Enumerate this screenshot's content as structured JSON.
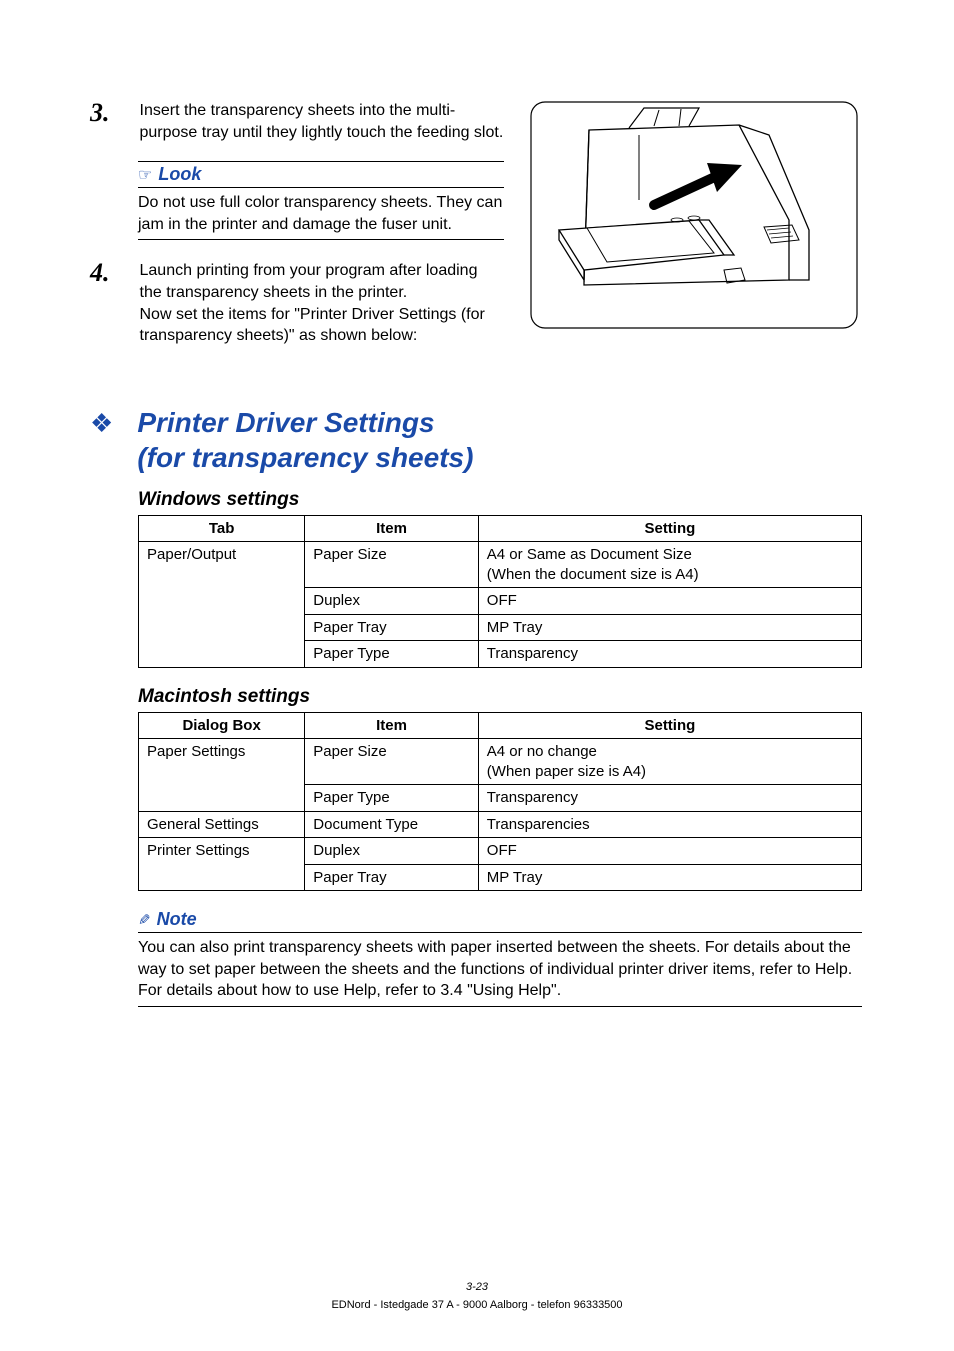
{
  "steps": {
    "s3": {
      "num": "3.",
      "text": "Insert the transparency sheets into the multi-purpose tray until they lightly touch the feeding slot."
    },
    "s4": {
      "num": "4.",
      "text": "Launch printing from your program after loading the transparency sheets in the printer.\nNow set the items for \"Printer Driver Settings (for transparency sheets)\" as shown below:"
    }
  },
  "look": {
    "label": "Look",
    "text": "Do not use full color transparency sheets. They can jam in the printer and damage the fuser unit."
  },
  "section": {
    "title_line1": "Printer Driver Settings",
    "title_line2": "(for transparency sheets)"
  },
  "windows": {
    "heading": "Windows settings",
    "th": {
      "c1": "Tab",
      "c2": "Item",
      "c3": "Setting"
    },
    "rows": {
      "r1": {
        "c1": "Paper/Output",
        "c2": "Paper Size",
        "c3": "A4 or Same as Document Size\n(When the document size is A4)"
      },
      "r2": {
        "c2": "Duplex",
        "c3": "OFF"
      },
      "r3": {
        "c2": "Paper Tray",
        "c3": "MP Tray"
      },
      "r4": {
        "c2": "Paper Type",
        "c3": "Transparency"
      }
    }
  },
  "mac": {
    "heading": "Macintosh settings",
    "th": {
      "c1": "Dialog Box",
      "c2": "Item",
      "c3": "Setting"
    },
    "rows": {
      "r1": {
        "c1": "Paper Settings",
        "c2": "Paper Size",
        "c3": "A4 or no change\n(When paper size is A4)"
      },
      "r2": {
        "c2": "Paper Type",
        "c3": "Transparency"
      },
      "r3": {
        "c1": "General Settings",
        "c2": "Document Type",
        "c3": "Transparencies"
      },
      "r4": {
        "c1": "Printer Settings",
        "c2": "Duplex",
        "c3": "OFF"
      },
      "r5": {
        "c2": "Paper Tray",
        "c3": "MP Tray"
      }
    }
  },
  "note": {
    "label": "Note",
    "text": "You can also print transparency sheets with paper inserted between the sheets. For details about the way to set paper between the sheets and the functions of individual printer driver items, refer to Help.\nFor details about how to use Help, refer to 3.4 \"Using Help\"."
  },
  "footer": {
    "page": "3-23",
    "address": "EDNord - Istedgade 37 A - 9000 Aalborg - telefon 96333500"
  }
}
